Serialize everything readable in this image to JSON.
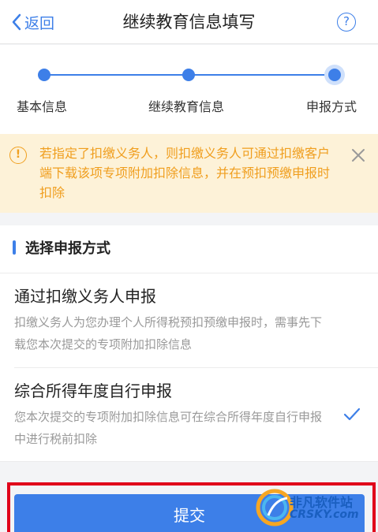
{
  "navbar": {
    "back_label": "返回",
    "title": "继续教育信息填写",
    "help_symbol": "?"
  },
  "steps": [
    {
      "label": "基本信息"
    },
    {
      "label": "继续教育信息"
    },
    {
      "label": "申报方式"
    }
  ],
  "notice": {
    "icon": "!",
    "text": "若指定了扣缴义务人，则扣缴义务人可通过扣缴客户端下载该项专项附加扣除信息，并在预扣预缴申报时扣除"
  },
  "section": {
    "title": "选择申报方式",
    "options": [
      {
        "title": "通过扣缴义务人申报",
        "desc": "扣缴义务人为您办理个人所得税预扣预缴申报时，需事先下载您本次提交的专项附加扣除信息",
        "selected": false
      },
      {
        "title": "综合所得年度自行申报",
        "desc": "您本次提交的专项附加扣除信息可在综合所得年度自行申报中进行税前扣除",
        "selected": true
      }
    ]
  },
  "submit_label": "提交",
  "watermark": {
    "text": "非凡软件站",
    "sub": "CRSKY.com"
  },
  "colors": {
    "accent": "#3d7fe8",
    "notice_bg": "#fdf2d8",
    "notice_text": "#f09e1e",
    "highlight": "#e0001a"
  }
}
